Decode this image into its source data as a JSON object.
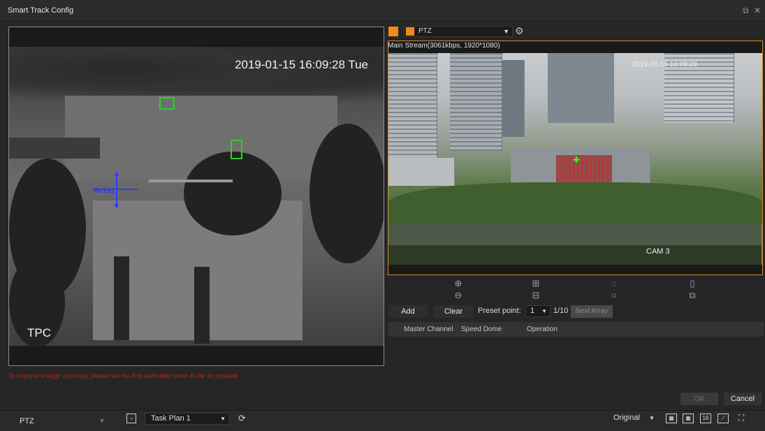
{
  "window": {
    "title": "Smart Track Config",
    "restore_icon": "restore-icon",
    "close_icon": "close-icon"
  },
  "left_video": {
    "timestamp": "2019-01-15 16:09:28 Tue",
    "channel_label": "TPC",
    "rule_label": "Rule1"
  },
  "hint": "To improve linkage accuracy, please set the first calibration point as far as possible",
  "right_panel": {
    "channel_color": "#f28a1a",
    "ptz_select": "PTZ",
    "stream_info": "Main Stream(3061kbps, 1920*1080)",
    "cam_label": "CAM 3",
    "cam_timestamp": "2019-01-15 16:09:28",
    "add_label": "Add",
    "clear_label": "Clear",
    "preset_label": "Preset point:",
    "preset_value": "1",
    "preset_count": "1/10",
    "next_array_label": "Next Array",
    "table_headers": [
      "Master Channel",
      "Speed Dome",
      "Operation"
    ]
  },
  "footer_buttons": {
    "ok_label": "OK",
    "cancel_label": "Cancel"
  },
  "bottom_bar": {
    "ptz_label": "PTZ",
    "task_plan": "Task Plan 1",
    "scale": "Original",
    "layout_16": "16"
  }
}
